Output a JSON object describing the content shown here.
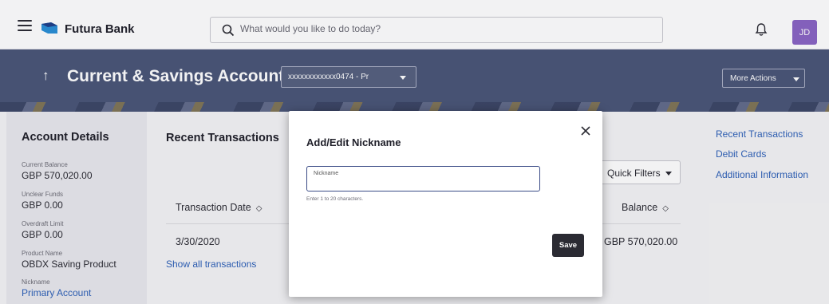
{
  "topbar": {
    "brand": "Futura Bank",
    "search_placeholder": "What would you like to do today?",
    "avatar_initials": "JD"
  },
  "header": {
    "title": "Current & Savings Account",
    "account_selected": "xxxxxxxxxxxx0474 - Pr",
    "more_actions": "More Actions"
  },
  "account_details": {
    "heading": "Account Details",
    "fields": [
      {
        "label": "Current Balance",
        "value": "GBP 570,020.00"
      },
      {
        "label": "Unclear Funds",
        "value": "GBP 0.00"
      },
      {
        "label": "Overdraft Limit",
        "value": "GBP 0.00"
      },
      {
        "label": "Product Name",
        "value": "OBDX Saving Product"
      },
      {
        "label": "Nickname",
        "value": "Primary Account"
      }
    ]
  },
  "transactions": {
    "heading": "Recent Transactions",
    "quick_filters": "Quick Filters",
    "columns": {
      "date": "Transaction Date",
      "balance": "Balance"
    },
    "rows": [
      {
        "date": "3/30/2020",
        "balance": "GBP 570,020.00"
      }
    ],
    "show_all": "Show all transactions"
  },
  "quick_links": [
    "Recent Transactions",
    "Debit Cards",
    "Additional Information"
  ],
  "modal": {
    "title": "Add/Edit Nickname",
    "field_label": "Nickname",
    "field_value": "",
    "hint": "Enter 1 to 20 characters.",
    "save": "Save"
  },
  "colors": {
    "band": "#4a5577",
    "link": "#2e61b8",
    "avatar": "#8a64c4",
    "primary_button": "#2b2b33"
  }
}
